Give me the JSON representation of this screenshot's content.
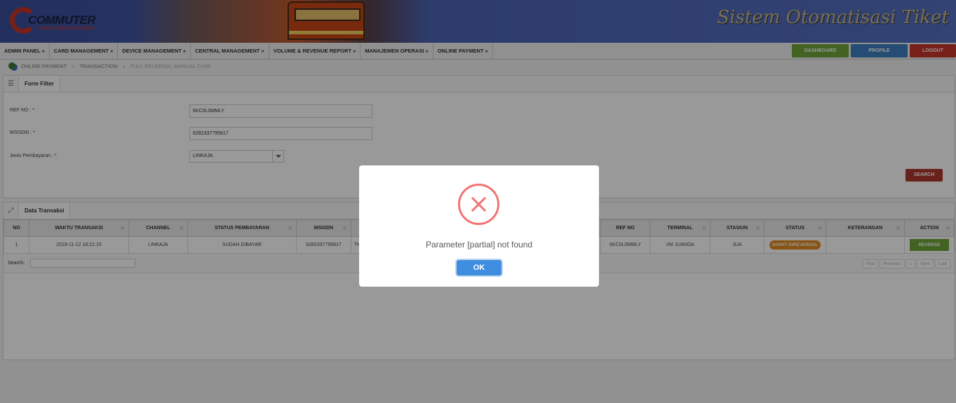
{
  "header": {
    "logo_text": "COMMUTER",
    "logo_sub": "KERETA COMMUTER INDONESIA",
    "app_title": "Sistem Otomatisasi Tiket"
  },
  "nav": {
    "items": [
      "ADMIN PANEL »",
      "CARD MANAGEMENT »",
      "DEVICE MANAGEMENT »",
      "CENTRAL MANAGEMENT »",
      "VOLUME & REVENUE REPORT »",
      "MANAJEMEN OPERASI »",
      "ONLINE PAYMENT »"
    ],
    "dashboard": "DASHBOARD",
    "profile": "PROFILE",
    "logout": "LOGOUT"
  },
  "breadcrumb": [
    "ONLINE PAYMENT",
    "TRANSACTION",
    "FULL REVERSAL MANUAL CVIM"
  ],
  "filter": {
    "title": "Form Filter",
    "ref_label": "REF NO : *",
    "ref_value": "6KC0L0MMLY",
    "msisdn_label": "MSISDN : *",
    "msisdn_value": "6282337795817",
    "jenis_label": "Jenis Pembayaran : *",
    "jenis_value": "LINKAJA",
    "search": "SEARCH"
  },
  "table": {
    "title": "Data Transaksi",
    "headers": [
      "NO",
      "WAKTU TRANSAKSI",
      "CHANNEL",
      "STATUS PEMBAYARAN",
      "MSISDN",
      "",
      "REF NO",
      "TERMINAL",
      "STASIUN",
      "STATUS",
      "KETERANGAN",
      "ACTION"
    ],
    "row": {
      "no": "1",
      "waktu": "2019-11-12 18:21:15",
      "channel": "LINKAJA",
      "status_bayar": "SUDAH DIBAYAR",
      "msisdn": "6282337795817",
      "partial": "TH",
      "ref": "6KC0L0MMLY",
      "terminal": "VM JUANDA",
      "stasiun": "JUA",
      "status": "DAPAT DIREVERSAL",
      "keterangan": "",
      "action": "REVERSE"
    },
    "search_label": "Search:",
    "pager": [
      "First",
      "Previous",
      "1",
      "Next",
      "Last"
    ]
  },
  "dialog": {
    "message": "Parameter [partial] not found",
    "ok": "OK"
  }
}
